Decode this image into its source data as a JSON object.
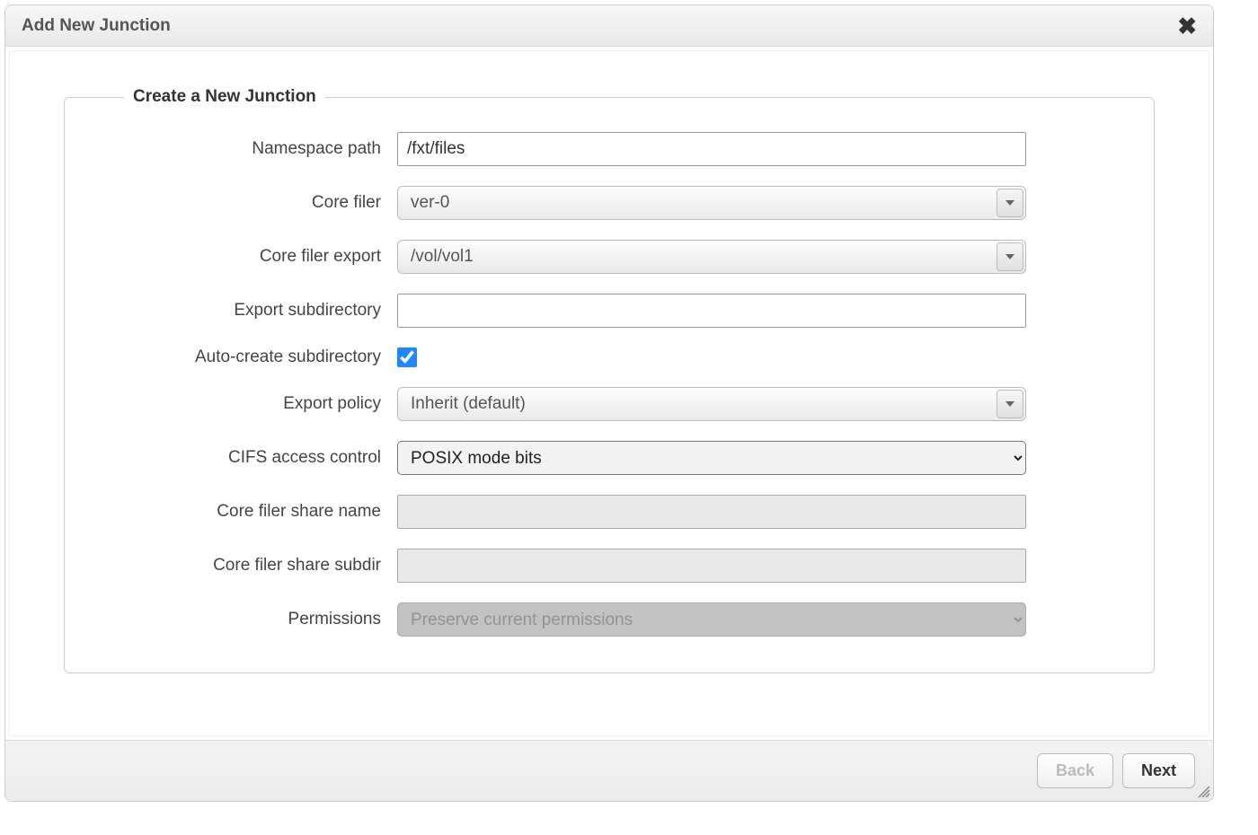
{
  "dialog": {
    "title": "Add New Junction"
  },
  "fieldset": {
    "legend": "Create a New Junction"
  },
  "form": {
    "namespace_path": {
      "label": "Namespace path",
      "value": "/fxt/files"
    },
    "core_filer": {
      "label": "Core filer",
      "value": "ver-0"
    },
    "core_filer_export": {
      "label": "Core filer export",
      "value": "/vol/vol1"
    },
    "export_subdirectory": {
      "label": "Export subdirectory",
      "value": ""
    },
    "auto_create_subdir": {
      "label": "Auto-create subdirectory",
      "checked": true
    },
    "export_policy": {
      "label": "Export policy",
      "value": "Inherit (default)"
    },
    "cifs_access_control": {
      "label": "CIFS access control",
      "value": "POSIX mode bits"
    },
    "core_filer_share_name": {
      "label": "Core filer share name",
      "value": ""
    },
    "core_filer_share_subdir": {
      "label": "Core filer share subdir",
      "value": ""
    },
    "permissions": {
      "label": "Permissions",
      "value": "Preserve current permissions"
    }
  },
  "buttons": {
    "back": "Back",
    "next": "Next"
  }
}
